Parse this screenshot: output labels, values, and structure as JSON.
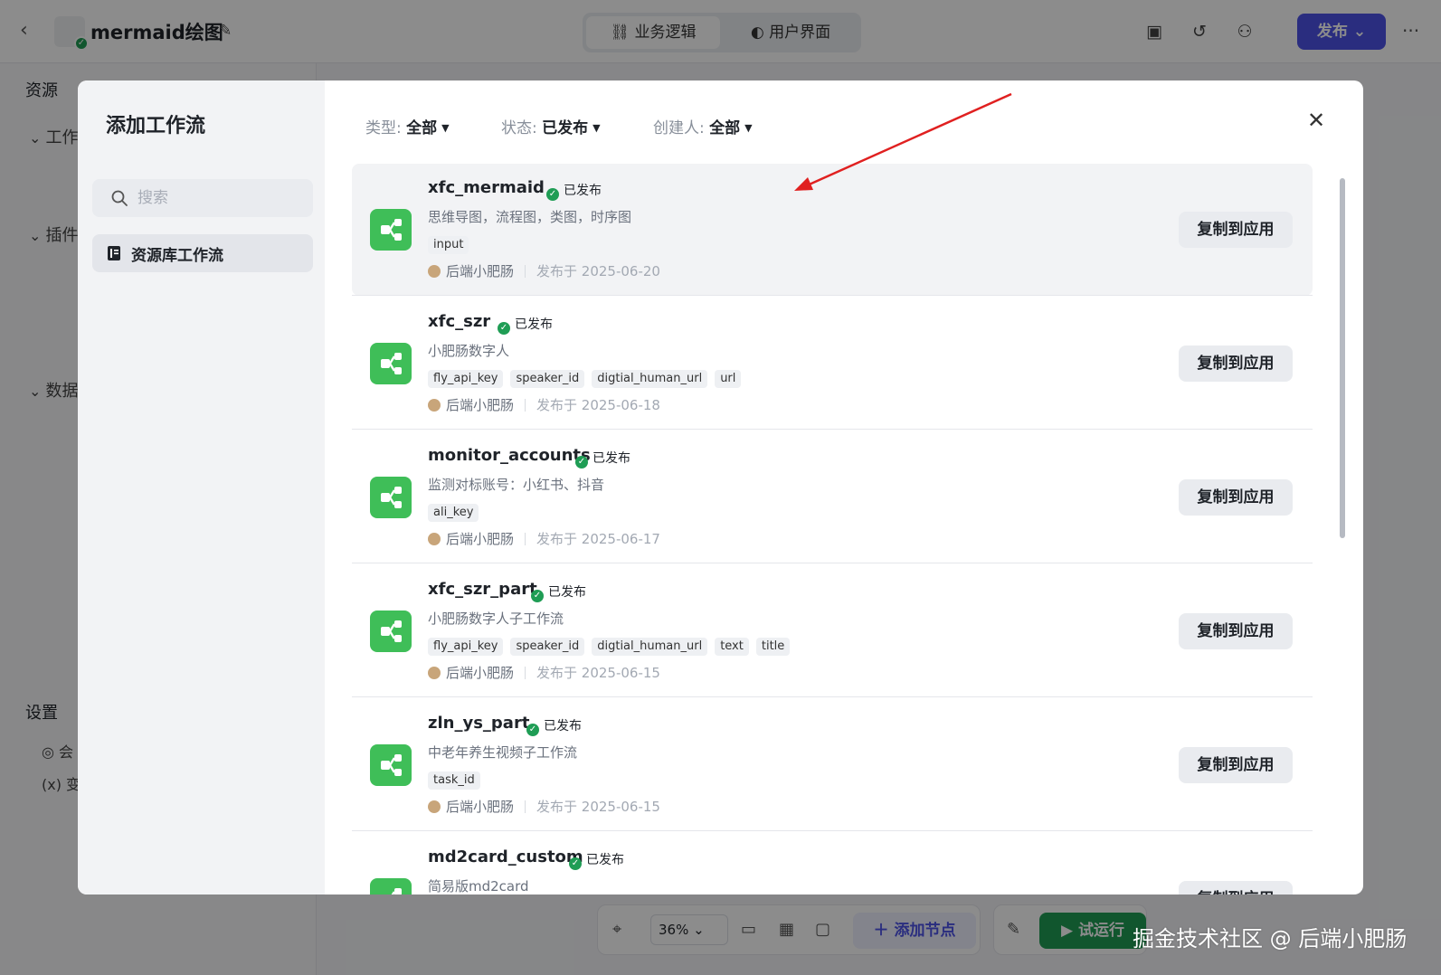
{
  "app": {
    "title": "mermaid绘图",
    "mode_tabs": [
      "业务逻辑",
      "用户界面"
    ],
    "publish_label": "发布"
  },
  "left_panel": {
    "resources_label": "资源",
    "sections": [
      "工作",
      "插件",
      "数据"
    ],
    "settings_label": "设置",
    "settings_items": [
      "会",
      "变"
    ]
  },
  "bottom_toolbar": {
    "zoom": "36%",
    "add_node_label": "添加节点",
    "run_label": "试运行"
  },
  "modal": {
    "title": "添加工作流",
    "search_placeholder": "搜索",
    "side_item": "资源库工作流",
    "filters": [
      {
        "key": "类型:",
        "value": "全部"
      },
      {
        "key": "状态:",
        "value": "已发布"
      },
      {
        "key": "创建人:",
        "value": "全部"
      }
    ],
    "copy_label": "复制到应用",
    "status_label": "已发布",
    "workflows": [
      {
        "name": "xfc_mermaid",
        "description": "思维导图，流程图，类图，时序图",
        "tags": [
          "input"
        ],
        "author": "后端小肥肠",
        "published": "发布于 2025-06-20"
      },
      {
        "name": "xfc_szr",
        "description": "小肥肠数字人",
        "tags": [
          "fly_api_key",
          "speaker_id",
          "digtial_human_url",
          "url"
        ],
        "author": "后端小肥肠",
        "published": "发布于 2025-06-18"
      },
      {
        "name": "monitor_accounts",
        "description": "监测对标账号：小红书、抖音",
        "tags": [
          "ali_key"
        ],
        "author": "后端小肥肠",
        "published": "发布于 2025-06-17"
      },
      {
        "name": "xfc_szr_part",
        "description": "小肥肠数字人子工作流",
        "tags": [
          "fly_api_key",
          "speaker_id",
          "digtial_human_url",
          "text",
          "title"
        ],
        "author": "后端小肥肠",
        "published": "发布于 2025-06-15"
      },
      {
        "name": "zln_ys_part",
        "description": "中老年养生视频子工作流",
        "tags": [
          "task_id"
        ],
        "author": "后端小肥肠",
        "published": "发布于 2025-06-15"
      },
      {
        "name": "md2card_custom",
        "description": "简易版md2card",
        "tags": [],
        "author": "",
        "published": ""
      }
    ]
  },
  "watermark": "掘金技术社区 @ 后端小肥肠",
  "colors": {
    "accent": "#4d53e8",
    "success": "#1f9d55",
    "workflow_icon": "#3fbe58",
    "arrow": "#e02020"
  }
}
